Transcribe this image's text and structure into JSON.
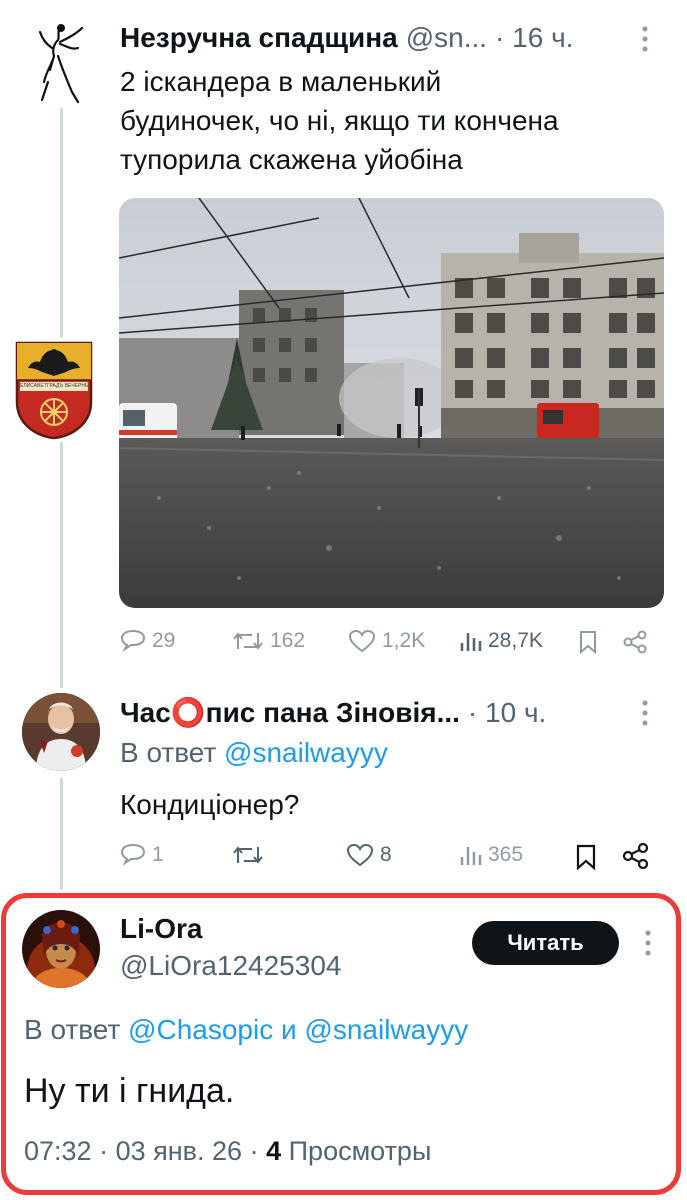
{
  "tweet1": {
    "name": "Незручна спадщина",
    "handle": "@sn...",
    "time": "· 16 ч.",
    "text_lines": [
      "2 іскандера в маленький",
      "будиночек, чо ні, якщо ти кончена",
      "тупорила скажена уйобіна"
    ],
    "replies": "29",
    "retweets": "162",
    "likes": "1,2K",
    "views": "28,7K"
  },
  "tweet2": {
    "name": "Час⭕пис пана Зіновія...",
    "time": "· 10 ч.",
    "reply_prefix": "В ответ",
    "reply_to": "@snailwayyy",
    "text": "Кондиціонер?",
    "replies": "1",
    "likes": "8",
    "views": "365"
  },
  "tweet3": {
    "name": "Li-Ora",
    "handle": "@LiOra12425304",
    "follow_label": "Читать",
    "reply_prefix": "В ответ",
    "reply_to_1": "@Chasopic",
    "reply_and": "и",
    "reply_to_2": "@snailwayyy",
    "text": "Ну ти і гнида.",
    "time": "07:32",
    "date": "03 янв. 26",
    "views_count": "4",
    "views_label": "Просмотры"
  },
  "coat_of_arms_text": "ЕЛИСАВЕТГРАДЪ ВЕЧЕРНІЙ",
  "colors": {
    "highlight": "#ef3a36",
    "link": "#1d9bf0",
    "muted": "#536471"
  }
}
